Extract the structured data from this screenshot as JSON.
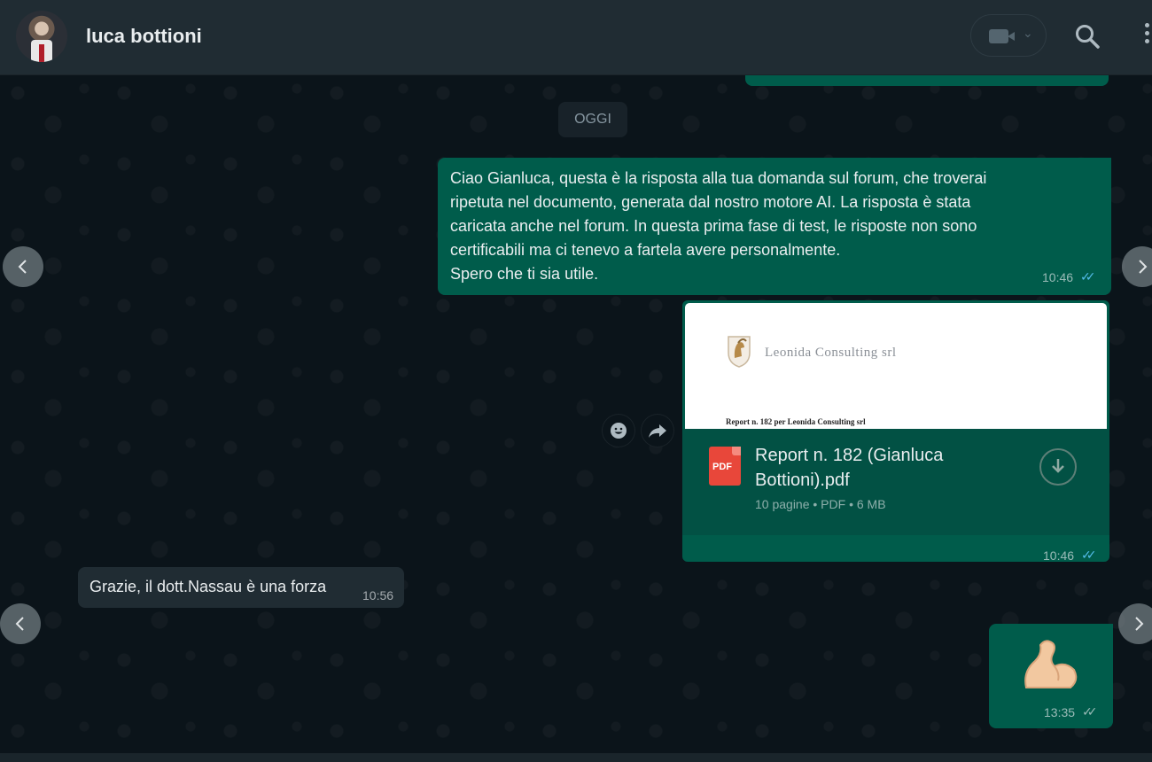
{
  "header": {
    "contact_name": "luca bottioni",
    "avatar": "contact-photo",
    "video_call_icon": "video-camera-icon",
    "search_icon": "search-icon",
    "menu_icon": "more-vertical-icon"
  },
  "chat": {
    "date_separator": "OGGI",
    "messages": [
      {
        "direction": "outgoing",
        "text": "Ciao Gianluca, questa è la risposta alla tua domanda sul forum, che troverai\nripetuta nel documento, generata dal nostro motore AI. La risposta è stata\ncaricata anche nel forum. In questa prima fase di test, le risposte non sono\ncertificabili ma ci tenevo a fartela avere personalmente.\nSpero che ti sia utile.",
        "time": "10:46",
        "status": "read"
      },
      {
        "direction": "outgoing",
        "type": "document",
        "preview_company": "Leonida Consulting srl",
        "preview_subtitle": "Report n. 182 per Leonida Consulting srl",
        "file_badge": "PDF",
        "file_name": "Report n. 182 (Gianluca Bottioni).pdf",
        "file_meta": "10 pagine • PDF • 6 MB",
        "time": "10:46",
        "status": "read"
      },
      {
        "direction": "incoming",
        "text": "Grazie, il dott.Nassau è una forza",
        "time": "10:56"
      },
      {
        "direction": "outgoing",
        "type": "emoji",
        "emoji": "💪",
        "time": "13:35",
        "status": "delivered"
      }
    ]
  },
  "colors": {
    "header_bg": "#202c33",
    "chat_bg": "#0b141a",
    "outgoing_bubble": "#005c4b",
    "incoming_bubble": "#202c33",
    "read_ticks": "#53bdeb"
  }
}
